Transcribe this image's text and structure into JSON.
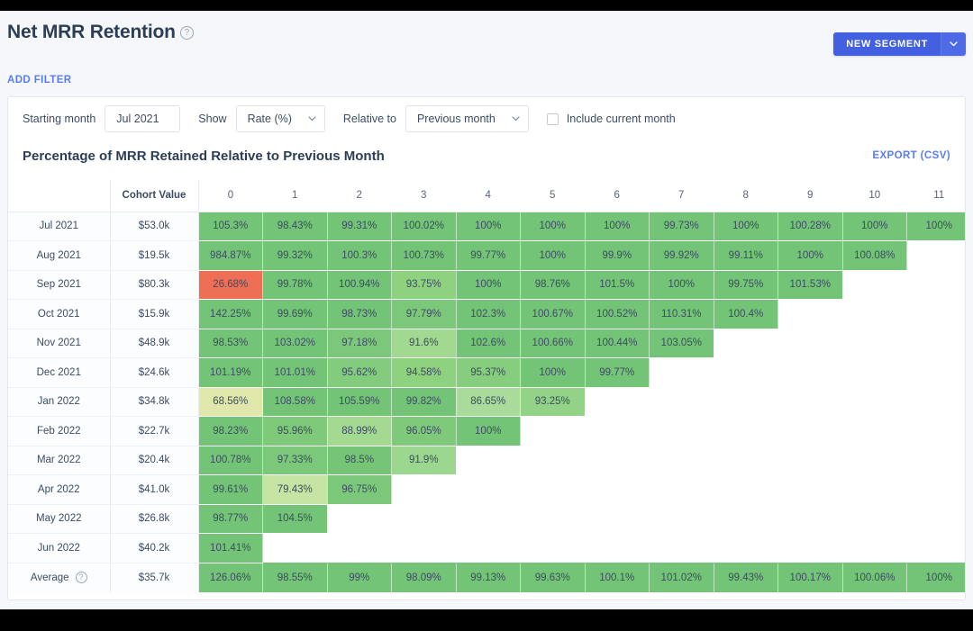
{
  "header": {
    "title": "Net MRR Retention",
    "help_icon": "question-circle-icon",
    "add_filter": "ADD FILTER",
    "new_segment": "NEW SEGMENT",
    "new_segment_caret": "chevron-down-icon"
  },
  "controls": {
    "starting_month_label": "Starting month",
    "starting_month_value": "Jul 2021",
    "show_label": "Show",
    "show_value": "Rate (%)",
    "relative_to_label": "Relative to",
    "relative_to_value": "Previous month",
    "include_current_month_label": "Include current month",
    "include_current_month_checked": false
  },
  "chart": {
    "title": "Percentage of MRR Retained Relative to Previous Month",
    "export_label": "EXPORT (CSV)"
  },
  "colors": {
    "accent": "#4360e0",
    "link": "#5b7cfa",
    "green_strong": "#73c476",
    "green_mid": "#87cc83",
    "green_light": "#a9dc9a",
    "green_pale": "#cfe7a8",
    "yellow_pale": "#e2e8b0",
    "red": "#ee6f55",
    "title": "#2c3e56"
  },
  "chart_data": {
    "type": "heatmap",
    "title": "Percentage of MRR Retained Relative to Previous Month",
    "xlabel": "",
    "ylabel": "",
    "row_header_labels": [
      "",
      "Cohort Value"
    ],
    "categories": [
      "0",
      "1",
      "2",
      "3",
      "4",
      "5",
      "6",
      "7",
      "8",
      "9",
      "10",
      "11"
    ],
    "rows": [
      {
        "month": "Jul 2021",
        "cohort_value": "$53.0k",
        "values": [
          "105.3%",
          "98.43%",
          "99.31%",
          "100.02%",
          "100%",
          "100%",
          "100%",
          "99.73%",
          "100%",
          "100.28%",
          "100%",
          "100%"
        ],
        "colors": [
          "#73c476",
          "#73c476",
          "#73c476",
          "#73c476",
          "#73c476",
          "#73c476",
          "#73c476",
          "#73c476",
          "#73c476",
          "#73c476",
          "#73c476",
          "#73c476"
        ]
      },
      {
        "month": "Aug 2021",
        "cohort_value": "$19.5k",
        "values": [
          "984.87%",
          "99.32%",
          "100.3%",
          "100.73%",
          "99.77%",
          "100%",
          "99.9%",
          "99.92%",
          "99.11%",
          "100%",
          "100.08%"
        ],
        "colors": [
          "#73c476",
          "#73c476",
          "#73c476",
          "#73c476",
          "#73c476",
          "#73c476",
          "#73c476",
          "#73c476",
          "#73c476",
          "#73c476",
          "#73c476"
        ]
      },
      {
        "month": "Sep 2021",
        "cohort_value": "$80.3k",
        "values": [
          "26.68%",
          "99.78%",
          "100.94%",
          "93.75%",
          "100%",
          "98.76%",
          "101.5%",
          "100%",
          "99.75%",
          "101.53%"
        ],
        "colors": [
          "#ee6f55",
          "#73c476",
          "#73c476",
          "#8ed17f",
          "#73c476",
          "#73c476",
          "#73c476",
          "#73c476",
          "#73c476",
          "#73c476"
        ]
      },
      {
        "month": "Oct 2021",
        "cohort_value": "$15.9k",
        "values": [
          "142.25%",
          "99.69%",
          "98.73%",
          "97.79%",
          "102.3%",
          "100.67%",
          "100.52%",
          "110.31%",
          "100.4%"
        ],
        "colors": [
          "#73c476",
          "#73c476",
          "#73c476",
          "#7cc87a",
          "#73c476",
          "#73c476",
          "#73c476",
          "#73c476",
          "#73c476"
        ]
      },
      {
        "month": "Nov 2021",
        "cohort_value": "$48.9k",
        "values": [
          "98.53%",
          "103.02%",
          "97.18%",
          "91.6%",
          "102.6%",
          "100.66%",
          "100.44%",
          "103.05%"
        ],
        "colors": [
          "#73c476",
          "#73c476",
          "#7cc87a",
          "#a2d991",
          "#73c476",
          "#73c476",
          "#73c476",
          "#73c476"
        ]
      },
      {
        "month": "Dec 2021",
        "cohort_value": "$24.6k",
        "values": [
          "101.19%",
          "101.01%",
          "95.62%",
          "94.58%",
          "95.37%",
          "100%",
          "99.77%"
        ],
        "colors": [
          "#73c476",
          "#73c476",
          "#83cb7d",
          "#8ed17f",
          "#86cd7e",
          "#73c476",
          "#73c476"
        ]
      },
      {
        "month": "Jan 2022",
        "cohort_value": "$34.8k",
        "values": [
          "68.56%",
          "108.58%",
          "105.59%",
          "99.82%",
          "86.65%",
          "93.25%"
        ],
        "colors": [
          "#dfe7ab",
          "#73c476",
          "#73c476",
          "#73c476",
          "#a9dc9a",
          "#92d387"
        ]
      },
      {
        "month": "Feb 2022",
        "cohort_value": "$22.7k",
        "values": [
          "98.23%",
          "95.96%",
          "88.99%",
          "96.05%",
          "100%"
        ],
        "colors": [
          "#73c476",
          "#7fc97b",
          "#a4d992",
          "#7fc97b",
          "#73c476"
        ]
      },
      {
        "month": "Mar 2022",
        "cohort_value": "$20.4k",
        "values": [
          "100.78%",
          "97.33%",
          "98.5%",
          "91.9%"
        ],
        "colors": [
          "#73c476",
          "#7cc87a",
          "#76c577",
          "#9bd78e"
        ]
      },
      {
        "month": "Apr 2022",
        "cohort_value": "$41.0k",
        "values": [
          "99.61%",
          "79.43%",
          "96.75%"
        ],
        "colors": [
          "#73c476",
          "#c6e4a4",
          "#7cc87a"
        ]
      },
      {
        "month": "May 2022",
        "cohort_value": "$26.8k",
        "values": [
          "98.77%",
          "104.5%"
        ],
        "colors": [
          "#73c476",
          "#73c476"
        ]
      },
      {
        "month": "Jun 2022",
        "cohort_value": "$40.2k",
        "values": [
          "101.41%"
        ],
        "colors": [
          "#73c476"
        ]
      }
    ],
    "average_row": {
      "label": "Average",
      "help_icon": "question-circle-icon",
      "cohort_value": "$35.7k",
      "values": [
        "126.06%",
        "98.55%",
        "99%",
        "98.09%",
        "99.13%",
        "99.63%",
        "100.1%",
        "101.02%",
        "99.43%",
        "100.17%",
        "100.06%",
        "100%"
      ],
      "colors": [
        "#73c476",
        "#73c476",
        "#73c476",
        "#73c476",
        "#73c476",
        "#73c476",
        "#73c476",
        "#73c476",
        "#73c476",
        "#73c476",
        "#73c476",
        "#73c476"
      ]
    }
  }
}
